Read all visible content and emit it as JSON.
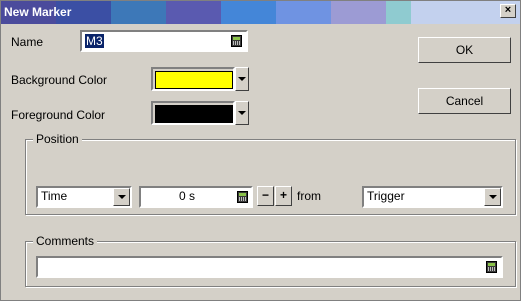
{
  "window": {
    "title": "New Marker",
    "titlebar_colors": [
      "#3c3c9c",
      "#3e78b4",
      "#5a5aa8",
      "#3a7ccd",
      "#5a88d6",
      "#6b8fe0",
      "#9797d1",
      "#92c8cd",
      "#c0d0ec"
    ],
    "close_glyph": "×"
  },
  "name": {
    "label": "Name",
    "value": "M3"
  },
  "background_color": {
    "label": "Background Color",
    "value": "#ffff00"
  },
  "foreground_color": {
    "label": "Foreground Color",
    "value": "#000000"
  },
  "buttons": {
    "ok": "OK",
    "cancel": "Cancel"
  },
  "position": {
    "title": "Position",
    "mode": "Time",
    "value": "0 s",
    "minus": "−",
    "plus": "+",
    "from_label": "from",
    "reference": "Trigger"
  },
  "comments": {
    "title": "Comments",
    "value": ""
  }
}
